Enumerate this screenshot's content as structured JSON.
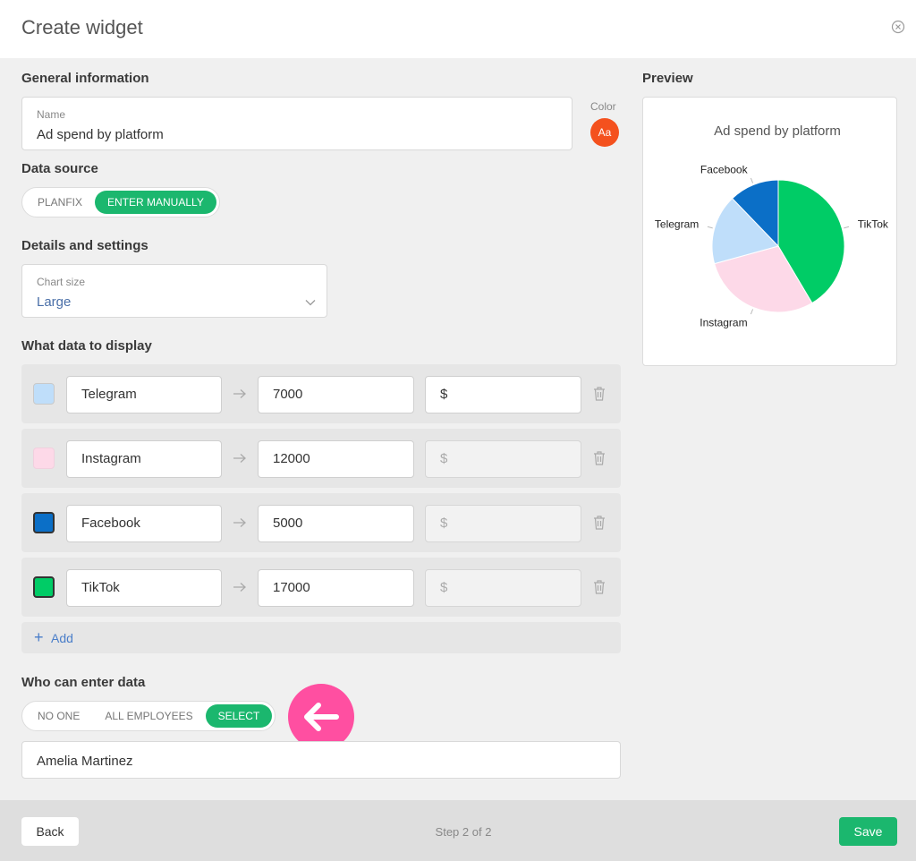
{
  "header": {
    "title": "Create widget"
  },
  "general": {
    "section_label": "General information",
    "name_label": "Name",
    "name_value": "Ad spend by platform",
    "color_label": "Color",
    "color_badge": "Aa",
    "color_value": "#f4511e"
  },
  "data_source": {
    "section_label": "Data source",
    "options": [
      "PLANFIX",
      "ENTER MANUALLY"
    ],
    "selected": "ENTER MANUALLY"
  },
  "details": {
    "section_label": "Details and settings",
    "chart_size_label": "Chart size",
    "chart_size_value": "Large"
  },
  "display": {
    "section_label": "What data to display",
    "rows": [
      {
        "color": "#bfdefa",
        "label": "Telegram",
        "value": "7000",
        "unit": "$",
        "unit_enabled": true
      },
      {
        "color": "#fdd9e8",
        "label": "Instagram",
        "value": "12000",
        "unit": "$",
        "unit_enabled": false
      },
      {
        "color": "#0b6fc7",
        "label": "Facebook",
        "value": "5000",
        "unit": "$",
        "unit_enabled": false
      },
      {
        "color": "#00cc66",
        "label": "TikTok",
        "value": "17000",
        "unit": "$",
        "unit_enabled": false
      }
    ],
    "add_label": "Add"
  },
  "access": {
    "section_label": "Who can enter data",
    "options": [
      "NO ONE",
      "ALL EMPLOYEES",
      "SELECT"
    ],
    "selected": "SELECT",
    "selected_user": "Amelia Martinez"
  },
  "preview": {
    "section_label": "Preview"
  },
  "chart_data": {
    "type": "pie",
    "title": "Ad spend by platform",
    "categories": [
      "TikTok",
      "Instagram",
      "Telegram",
      "Facebook"
    ],
    "values": [
      17000,
      12000,
      7000,
      5000
    ],
    "colors": [
      "#00cc66",
      "#fdd9e8",
      "#bfdefa",
      "#0b6fc7"
    ]
  },
  "footer": {
    "back_label": "Back",
    "step_label": "Step 2 of 2",
    "save_label": "Save"
  }
}
